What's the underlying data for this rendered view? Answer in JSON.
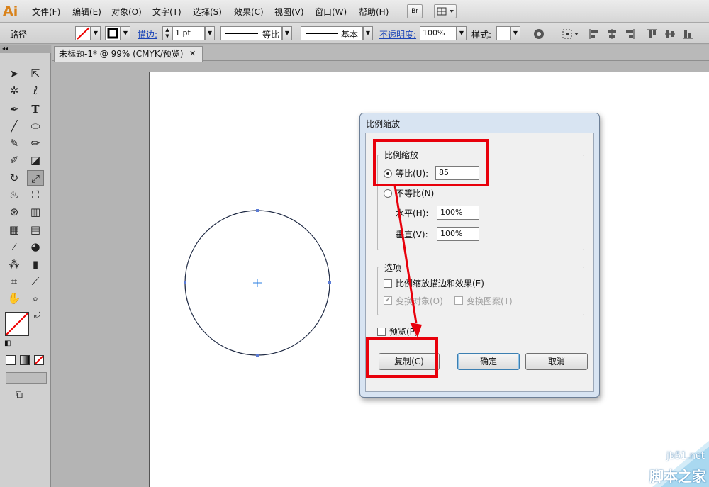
{
  "app": {
    "logo": "Ai"
  },
  "menu": [
    "文件(F)",
    "编辑(E)",
    "对象(O)",
    "文字(T)",
    "选择(S)",
    "效果(C)",
    "视图(V)",
    "窗口(W)",
    "帮助(H)"
  ],
  "menu_icons": {
    "bridge": "Br",
    "workspace": "workspace-icon"
  },
  "control": {
    "type_label": "路径",
    "stroke_label": "描边:",
    "stroke_weight": "1 pt",
    "profile_label": "等比",
    "brush_label": "基本",
    "opacity_label": "不透明度:",
    "opacity_value": "100%",
    "style_label": "样式:"
  },
  "tab": {
    "title": "未标题-1* @ 99% (CMYK/预览)",
    "close": "✕"
  },
  "dialog": {
    "title": "比例缩放",
    "group_scale": "比例缩放",
    "uniform_label": "等比(U):",
    "uniform_value": "85",
    "nonuniform_label": "不等比(N)",
    "horizontal_label": "水平(H):",
    "horizontal_value": "100%",
    "vertical_label": "垂直(V):",
    "vertical_value": "100%",
    "group_options": "选项",
    "scale_strokes_label": "比例缩放描边和效果(E)",
    "transform_objects_label": "变换对象(O)",
    "transform_patterns_label": "变换图案(T)",
    "preview_label": "预览(P)",
    "copy_label": "复制(C)",
    "ok_label": "确定",
    "cancel_label": "取消"
  },
  "watermark": {
    "site": "jb51.net",
    "name": "脚本之家"
  },
  "colors": {
    "highlight": "#e8000b",
    "accent": "#d9821a",
    "dialog_frame": "#d8e4f2"
  }
}
